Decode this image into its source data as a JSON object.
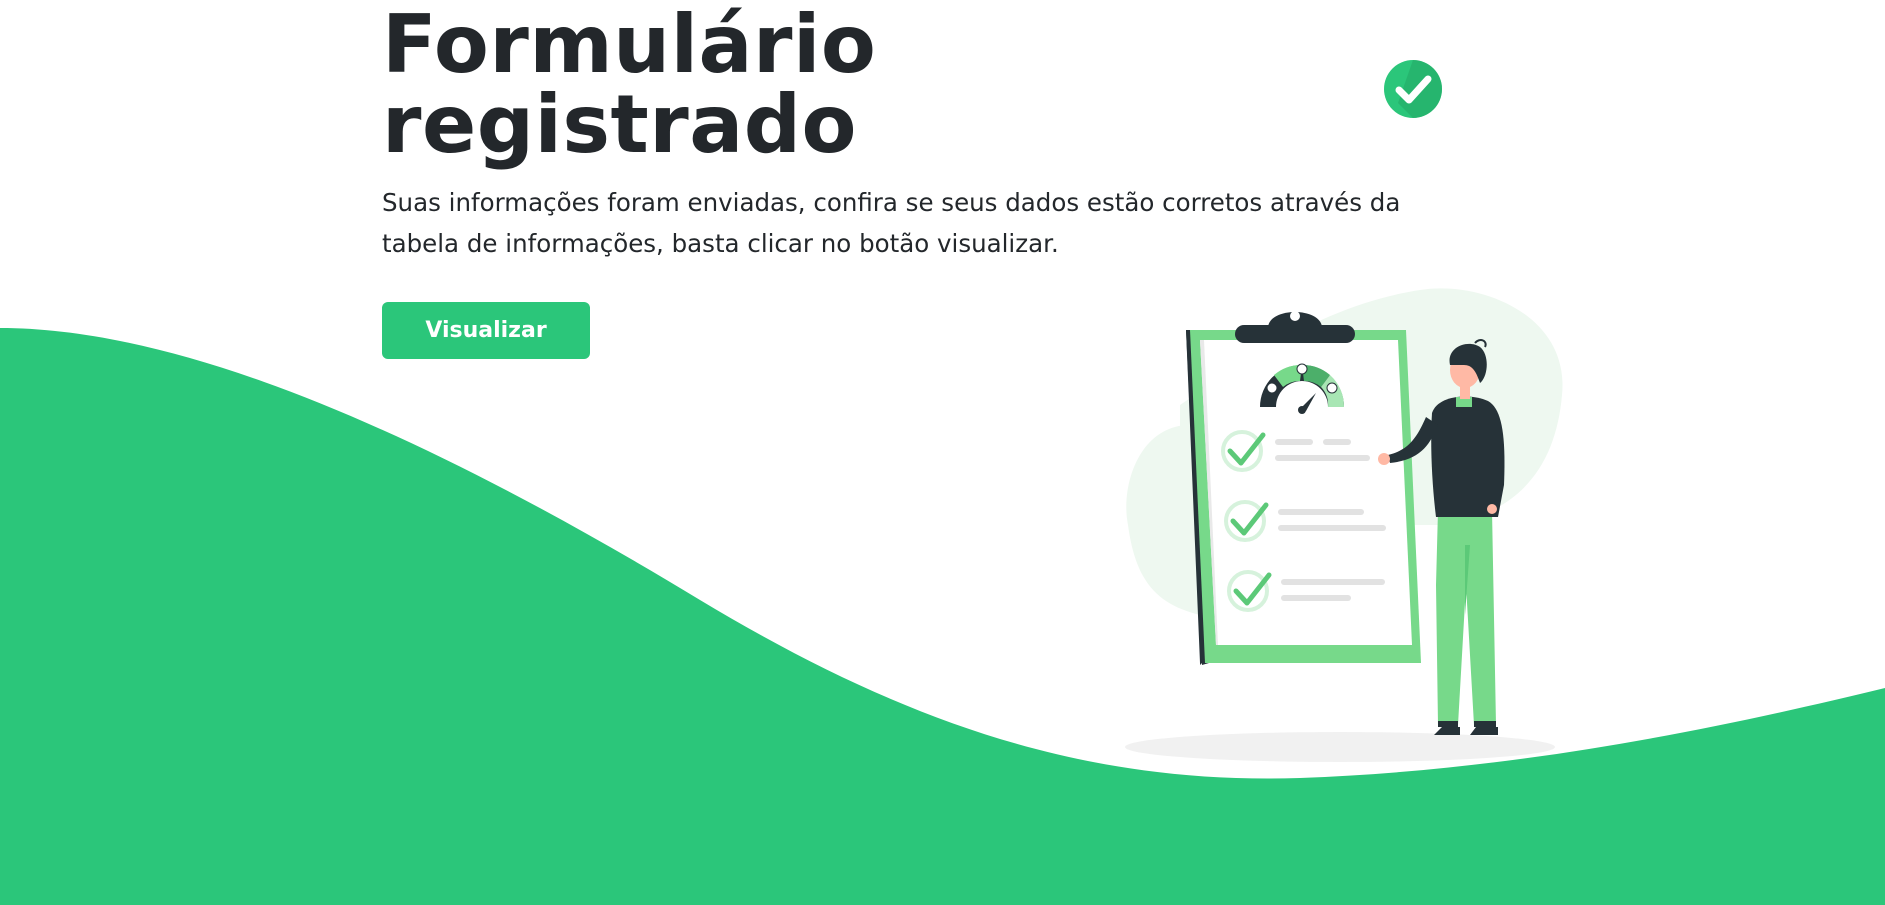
{
  "header": {
    "title": "Formulário registrado",
    "check_icon": "check-circle-icon"
  },
  "main": {
    "description": "Suas informações foram enviadas, confira se seus dados estão corretos através da tabela de informações, basta clicar no botão visualizar.",
    "view_button_label": "Visualizar"
  },
  "illustration": {
    "name": "checklist-illustration",
    "rating_faces": [
      "sad-face-icon",
      "neutral-face-icon",
      "happy-face-icon"
    ],
    "checklist_items": 3
  },
  "colors": {
    "accent": "#2bc67a",
    "light_green": "#77d98a",
    "dark": "#263238",
    "text": "#23272b",
    "background": "#ffffff"
  }
}
